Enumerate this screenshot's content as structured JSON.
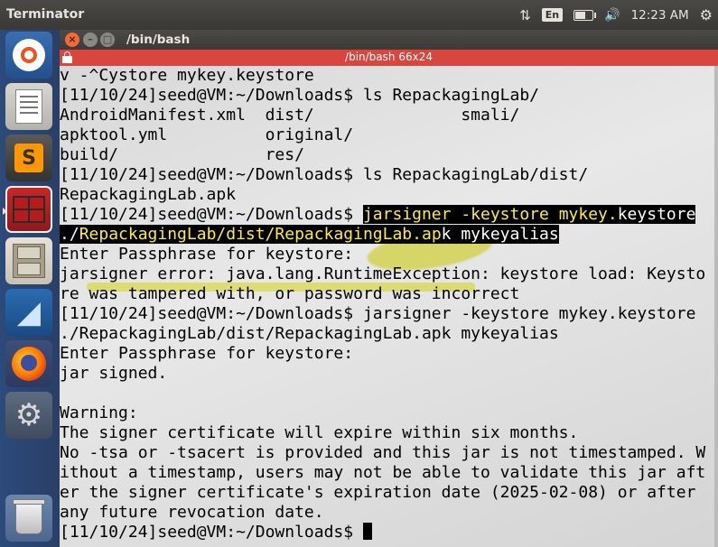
{
  "top_panel": {
    "app_name": "Terminator",
    "lang": "En",
    "battery_level": 0.6,
    "time": "12:23 AM"
  },
  "window": {
    "title": "/bin/bash",
    "terminal_header": "/bin/bash 66x24"
  },
  "terminal": {
    "lines": [
      "v -^Cystore mykey.keystore",
      "[11/10/24]seed@VM:~/Downloads$ ls RepackagingLab/",
      "AndroidManifest.xml  dist/               smali/",
      "apktool.yml          original/",
      "build/               res/",
      "[11/10/24]seed@VM:~/Downloads$ ls RepackagingLab/dist/",
      "RepackagingLab.apk",
      "Enter Passphrase for keystore:",
      "jarsigner error: java.lang.RuntimeException: keystore load: Keysto",
      "re was tampered with, or password was incorrect",
      "[11/10/24]seed@VM:~/Downloads$ jarsigner -keystore mykey.keystore",
      "./RepackagingLab/dist/RepackagingLab.apk mykeyalias",
      "Enter Passphrase for keystore:",
      "jar signed.",
      "",
      "Warning:",
      "The signer certificate will expire within six months.",
      "No -tsa or -tsacert is provided and this jar is not timestamped. W",
      "ithout a timestamp, users may not be able to validate this jar aft",
      "er the signer certificate's expiration date (2025-02-08) or after",
      "any future revocation date."
    ],
    "hl_prompt": "[11/10/24]seed@VM:~/Downloads$ ",
    "hl_cmd_a": "jarsigner -keystore mykey.",
    "hl_cmd_b": "keystore",
    "hl_path_a": "./",
    "hl_path_b": "RepackagingLab/dist/RepackagingLab.ap",
    "hl_path_c": "k mykeyalias",
    "final_prompt": "[11/10/24]seed@VM:~/Downloads$ "
  }
}
